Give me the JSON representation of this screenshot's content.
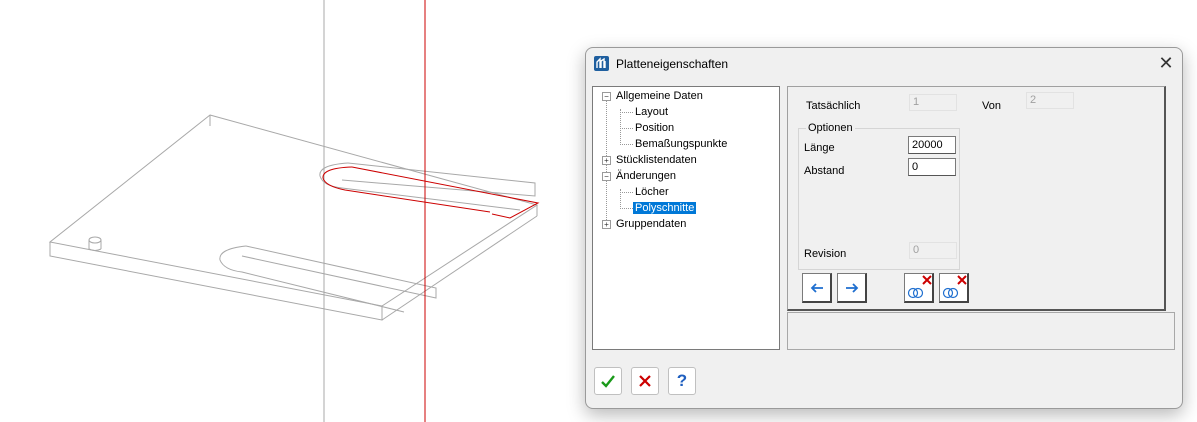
{
  "dialog": {
    "title": "Platteneigenschaften",
    "close_glyph": "✕",
    "app_icon": "app-logo-icon"
  },
  "tree": {
    "nodes": [
      {
        "label": "Allgemeine Daten",
        "expander": "−"
      },
      {
        "label": "Layout"
      },
      {
        "label": "Position"
      },
      {
        "label": "Bemaßungspunkte"
      },
      {
        "label": "Stücklistendaten",
        "expander": "+"
      },
      {
        "label": "Änderungen",
        "expander": "−"
      },
      {
        "label": "Löcher"
      },
      {
        "label": "Polyschnitte",
        "selected": true
      },
      {
        "label": "Gruppendaten",
        "expander": "+"
      }
    ]
  },
  "panel": {
    "tatsaechlich_label": "Tatsächlich",
    "tatsaechlich_value": "1",
    "von_label": "Von",
    "von_value": "2",
    "options_title": "Optionen",
    "laenge_label": "Länge",
    "laenge_value": "20000",
    "abstand_label": "Abstand",
    "abstand_value": "0",
    "revision_label": "Revision",
    "revision_value": "0"
  },
  "toolbar": {
    "prev_icon": "arrow-left-icon",
    "next_icon": "arrow-right-icon",
    "delete_icon_1": "delete-polycut-icon",
    "delete_icon_2": "delete-all-polycuts-icon"
  },
  "buttons": {
    "ok_icon": "checkmark-icon",
    "cancel_icon": "cancel-icon",
    "help_glyph": "?"
  },
  "colors": {
    "accent": "#0078d7",
    "cut_line": "#cc0000",
    "ok": "#1a9a1a",
    "help": "#1f5fbf"
  }
}
